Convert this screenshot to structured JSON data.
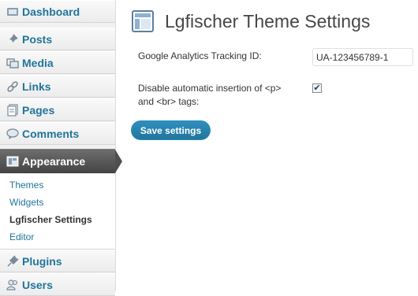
{
  "sidebar": {
    "items": [
      {
        "label": "Dashboard",
        "icon": "dashboard-icon"
      },
      {
        "label": "Posts",
        "icon": "pin-icon"
      },
      {
        "label": "Media",
        "icon": "media-icon"
      },
      {
        "label": "Links",
        "icon": "link-icon"
      },
      {
        "label": "Pages",
        "icon": "pages-icon"
      },
      {
        "label": "Comments",
        "icon": "comment-icon"
      },
      {
        "label": "Appearance",
        "icon": "appearance-icon"
      },
      {
        "label": "Plugins",
        "icon": "plugin-icon"
      },
      {
        "label": "Users",
        "icon": "users-icon"
      }
    ],
    "appearance_submenu": [
      {
        "label": "Themes"
      },
      {
        "label": "Widgets"
      },
      {
        "label": "Lgfischer Settings",
        "current": true
      },
      {
        "label": "Editor"
      }
    ]
  },
  "main": {
    "title": "Lgfischer Theme Settings",
    "tracking_label": "Google Analytics Tracking ID:",
    "tracking_value": "UA-123456789-1",
    "disable_label_line1": "Disable automatic insertion of <p>",
    "disable_label_line2": "and <br> tags:",
    "disable_checked": true,
    "save_label": "Save settings"
  },
  "colors": {
    "link": "#21759b",
    "active_menu": "#464646",
    "button": "#21759b"
  }
}
